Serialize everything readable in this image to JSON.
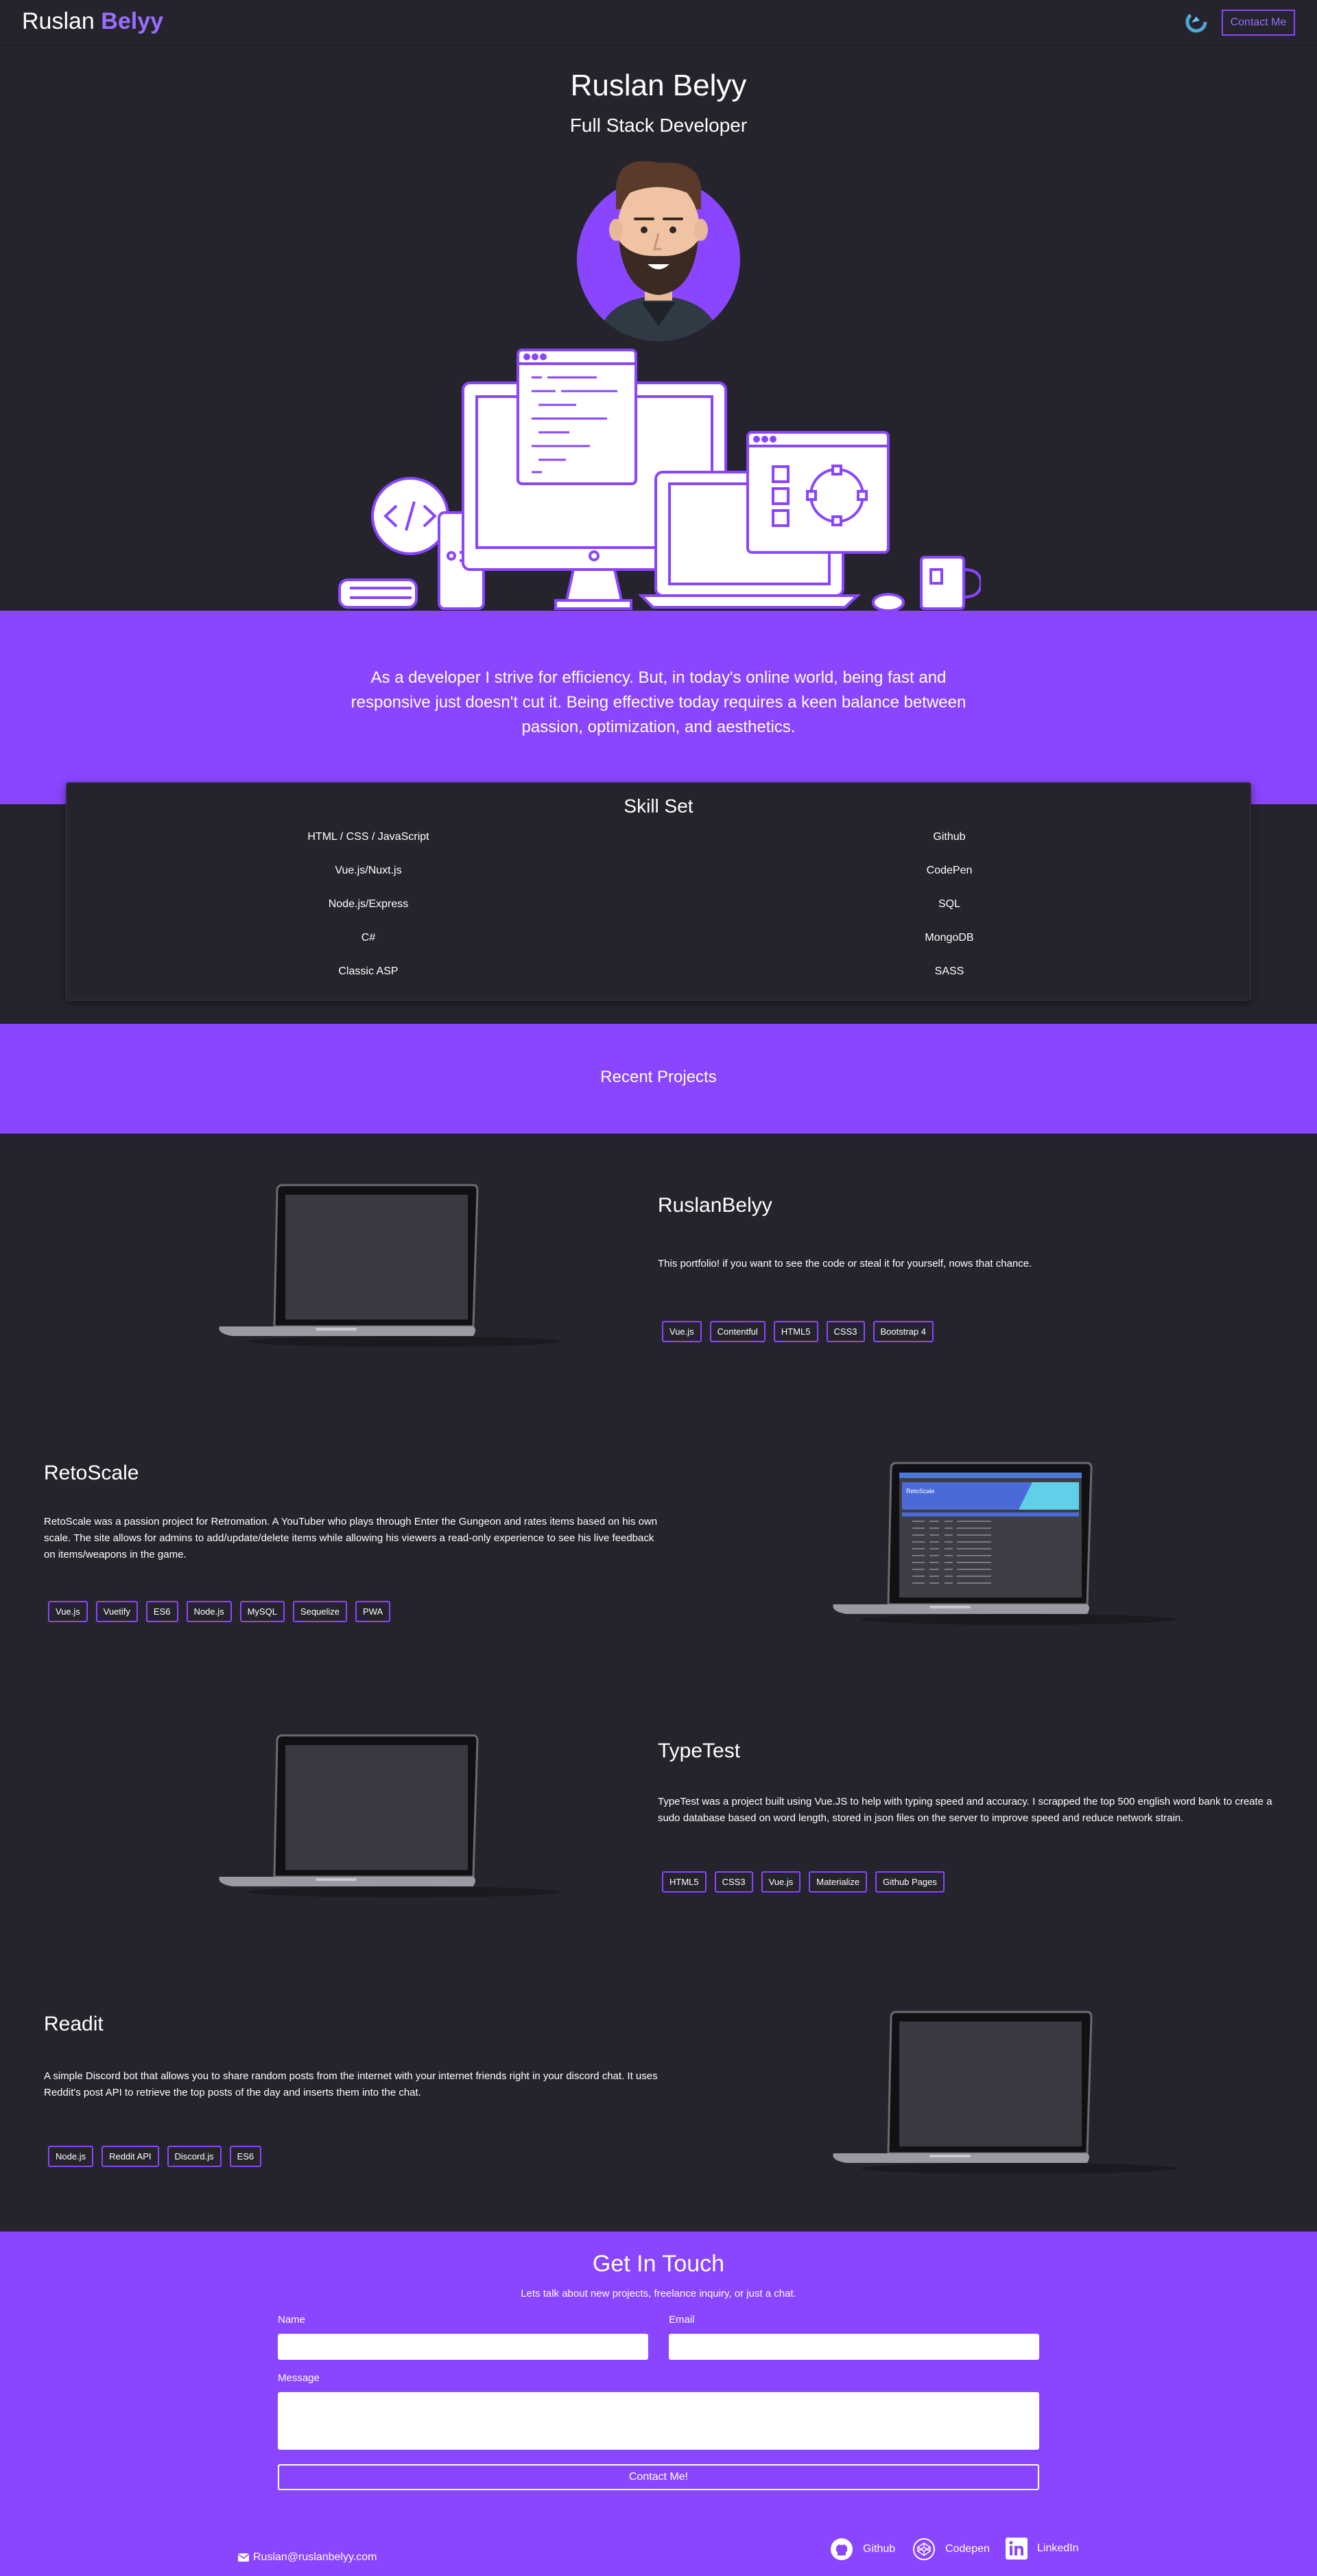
{
  "nav": {
    "brand_first": "Ruslan",
    "brand_last": "Belyy",
    "contact_label": "Contact Me"
  },
  "hero": {
    "name": "Ruslan Belyy",
    "role": "Full Stack Developer"
  },
  "intro": {
    "text": "As a developer I strive for efficiency. But, in today's online world, being fast and responsive just doesn't cut it. Being effective today requires a keen balance between passion, optimization, and aesthetics."
  },
  "skills": {
    "title": "Skill Set",
    "left": [
      "HTML / CSS / JavaScript",
      "Vue.js/Nuxt.js",
      "Node.js/Express",
      "C#",
      "Classic ASP"
    ],
    "right": [
      "Github",
      "CodePen",
      "SQL",
      "MongoDB",
      "SASS"
    ]
  },
  "projects_header": "Recent Projects",
  "projects": [
    {
      "title": "RuslanBelyy",
      "description": "This portfolio! if you want to see the code or steal it for yourself, nows that chance.",
      "tags": [
        "Vue.js",
        "Contentful",
        "HTML5",
        "CSS3",
        "Bootstrap 4"
      ]
    },
    {
      "title": "RetoScale",
      "description": "RetoScale was a passion project for Retromation. A YouTuber who plays through Enter the Gungeon and rates items based on his own scale. The site allows for admins to add/update/delete items while allowing his viewers a read-only experience to see his live feedback on items/weapons in the game.",
      "tags": [
        "Vue.js",
        "Vuetify",
        "ES6",
        "Node.js",
        "MySQL",
        "Sequelize",
        "PWA"
      ],
      "screen_title": "RetoScale"
    },
    {
      "title": "TypeTest",
      "description": "TypeTest was a project built using Vue.JS to help with typing speed and accuracy. I scrapped the top 500 english word bank to create a sudo database based on word length, stored in json files on the server to improve speed and reduce network strain.",
      "tags": [
        "HTML5",
        "CSS3",
        "Vue.js",
        "Materialize",
        "Github Pages"
      ]
    },
    {
      "title": "Readit",
      "description": "A simple Discord bot that allows you to share random posts from the internet with your internet friends right in your discord chat. It uses Reddit's post API to retrieve the top posts of the day and inserts them into the chat.",
      "tags": [
        "Node.js",
        "Reddit API",
        "Discord.js",
        "ES6"
      ]
    }
  ],
  "contact": {
    "title": "Get In Touch",
    "subtitle": "Lets talk about new projects, freelance inquiry, or just a chat.",
    "name_label": "Name",
    "email_label": "Email",
    "message_label": "Message",
    "submit_label": "Contact Me!",
    "email": "Ruslan@ruslanbelyy.com",
    "links": [
      "Github",
      "Codepen",
      "LinkedIn"
    ]
  },
  "colors": {
    "accent": "#8a45ff",
    "background": "#25242d",
    "brand_highlight": "#9b6dff"
  }
}
